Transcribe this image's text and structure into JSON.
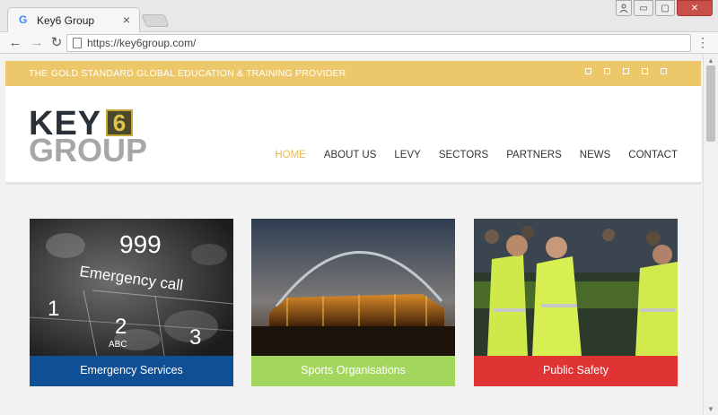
{
  "browser": {
    "tab_title": "Key6 Group",
    "tab_favicon": "G",
    "tab_close": "×",
    "url": "https://key6group.com/",
    "back": "←",
    "forward": "→",
    "reload": "↻",
    "menu": "⋮",
    "window_buttons": {
      "minimize": "▭",
      "maximize": "▢",
      "close": "✕"
    }
  },
  "site": {
    "tagline": "THE GOLD STANDARD GLOBAL EDUCATION & TRAINING PROVIDER",
    "social_icons": [
      "social-icon-1",
      "social-icon-2",
      "social-icon-3",
      "social-icon-4",
      "social-icon-5"
    ],
    "logo": {
      "key": "KEY",
      "six": "6",
      "group": "GROUP"
    },
    "nav": [
      {
        "label": "HOME",
        "active": true
      },
      {
        "label": "ABOUT US",
        "active": false
      },
      {
        "label": "LEVY",
        "active": false
      },
      {
        "label": "SECTORS",
        "active": false
      },
      {
        "label": "PARTNERS",
        "active": false
      },
      {
        "label": "NEWS",
        "active": false
      },
      {
        "label": "CONTACT",
        "active": false
      }
    ],
    "cards": [
      {
        "label": "Emergency Services",
        "color": "#0f4f95",
        "image": "emergency-call-keypad-image",
        "overlay_999": "999",
        "overlay_text": "Emergency call"
      },
      {
        "label": "Sports Organisations",
        "color": "#a3d65c",
        "image": "stadium-arch-image"
      },
      {
        "label": "Public Safety",
        "color": "#e03333",
        "image": "stewards-hi-vis-image"
      }
    ]
  },
  "colors": {
    "accent_gold": "#edc86a",
    "active_nav": "#e8b84a",
    "card_blue": "#0f4f95",
    "card_green": "#a3d65c",
    "card_red": "#e03333"
  }
}
